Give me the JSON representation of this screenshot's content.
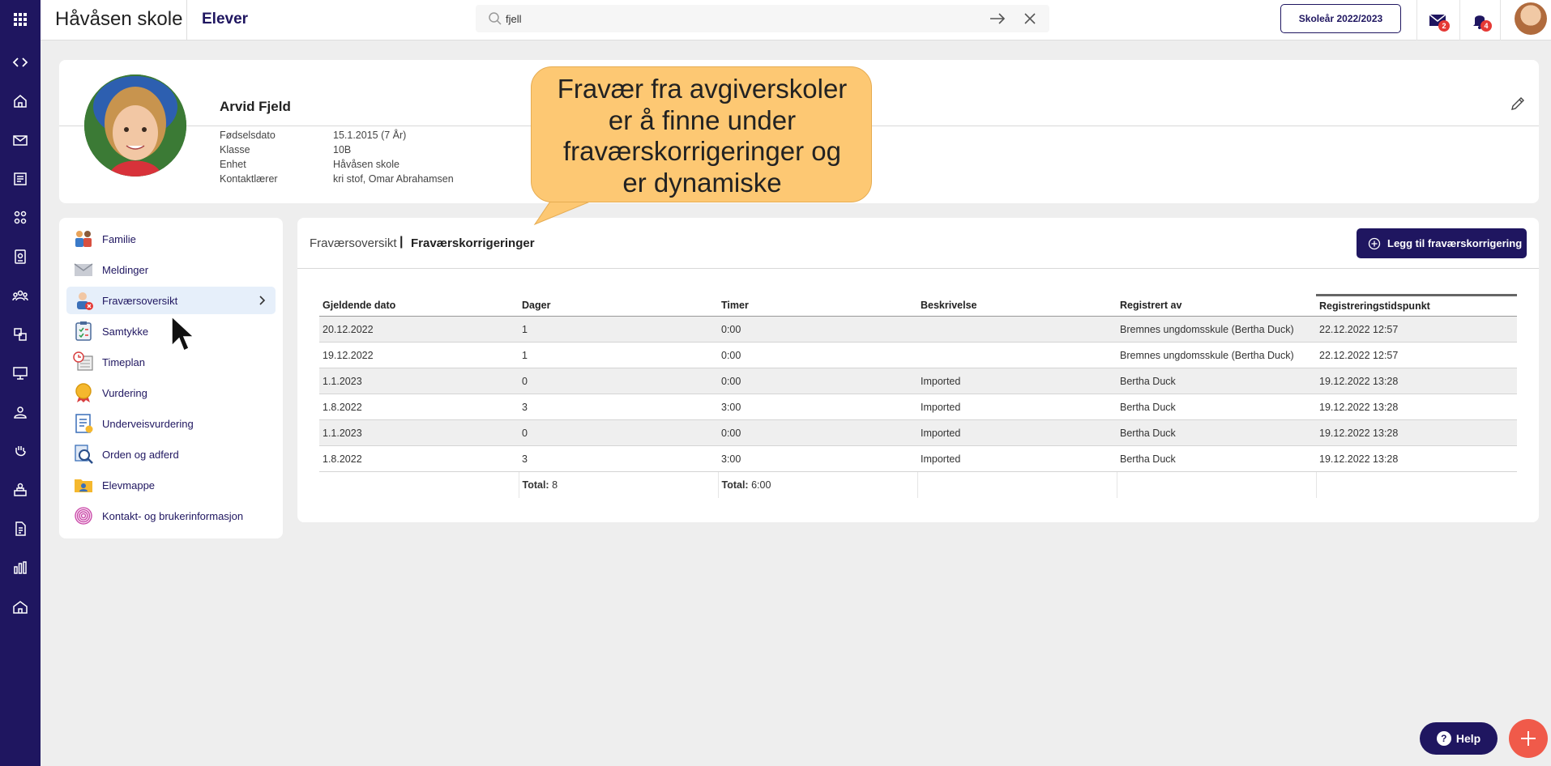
{
  "header": {
    "school_name": "Håvåsen skole",
    "module_title": "Elever",
    "search_value": "fjell",
    "school_year_button": "Skoleår 2022/2023",
    "messages_badge": "2",
    "notifications_badge": "4"
  },
  "rail": {
    "icons": [
      "apps-grid-icon",
      "code-toggle-icon",
      "home-icon",
      "mail-icon",
      "news-icon",
      "people-grid-icon",
      "badge-icon",
      "group-icon",
      "hierarchy-icon",
      "classroom-icon",
      "student-icon",
      "hand-icon",
      "desk-icon",
      "document-icon",
      "bar-chart-icon",
      "school-icon"
    ]
  },
  "student": {
    "name": "Arvid Fjeld",
    "fields": [
      {
        "label": "Fødselsdato",
        "value": "15.1.2015 (7 År)"
      },
      {
        "label": "Klasse",
        "value": "10B"
      },
      {
        "label": "Enhet",
        "value": "Håvåsen skole"
      },
      {
        "label": "Kontaktlærer",
        "value": "kri stof, Omar Abrahamsen"
      }
    ]
  },
  "callout": {
    "lines": [
      "Fravær fra avgiverskoler",
      "er å finne under",
      "fraværskorrigeringer og",
      "er dynamiske"
    ]
  },
  "menu": {
    "items": [
      {
        "label": "Familie",
        "icon": "family-icon"
      },
      {
        "label": "Meldinger",
        "icon": "envelope-icon"
      },
      {
        "label": "Fraværsoversikt",
        "icon": "absence-icon"
      },
      {
        "label": "Samtykke",
        "icon": "clipboard-icon"
      },
      {
        "label": "Timeplan",
        "icon": "schedule-icon"
      },
      {
        "label": "Vurdering",
        "icon": "medal-icon"
      },
      {
        "label": "Underveisvurdering",
        "icon": "checklist-icon"
      },
      {
        "label": "Orden og adferd",
        "icon": "magnifier-document-icon"
      },
      {
        "label": "Elevmappe",
        "icon": "folder-icon"
      },
      {
        "label": "Kontakt- og brukerinformasjon",
        "icon": "fingerprint-icon"
      }
    ],
    "active_index": 2
  },
  "panel": {
    "breadcrumb_parent": "Fraværsoversikt",
    "breadcrumb_separator": "|",
    "breadcrumb_current": "Fraværskorrigeringer",
    "add_button": "Legg til fraværskorrigering",
    "columns": [
      "Gjeldende dato",
      "Dager",
      "Timer",
      "Beskrivelse",
      "Registrert av",
      "Registreringstidspunkt"
    ],
    "rows": [
      [
        "20.12.2022",
        "1",
        "0:00",
        "",
        "Bremnes ungdomsskule (Bertha Duck)",
        "22.12.2022 12:57"
      ],
      [
        "19.12.2022",
        "1",
        "0:00",
        "",
        "Bremnes ungdomsskule (Bertha Duck)",
        "22.12.2022 12:57"
      ],
      [
        "1.1.2023",
        "0",
        "0:00",
        "Imported",
        "Bertha Duck",
        "19.12.2022 13:28"
      ],
      [
        "1.8.2022",
        "3",
        "3:00",
        "Imported",
        "Bertha Duck",
        "19.12.2022 13:28"
      ],
      [
        "1.1.2023",
        "0",
        "0:00",
        "Imported",
        "Bertha Duck",
        "19.12.2022 13:28"
      ],
      [
        "1.8.2022",
        "3",
        "3:00",
        "Imported",
        "Bertha Duck",
        "19.12.2022 13:28"
      ]
    ],
    "totals": {
      "days_label": "Total:",
      "days_value": "8",
      "hours_label": "Total:",
      "hours_value": "6:00"
    }
  },
  "floating": {
    "help_button": "Help",
    "help_icon": "question-icon",
    "fab_icon": "plus-icon"
  },
  "colors": {
    "brand": "#1f1660",
    "callout": "#fdc873",
    "fab": "#f05a4a",
    "badge": "#e53935",
    "active_menu": "#e6effa"
  }
}
